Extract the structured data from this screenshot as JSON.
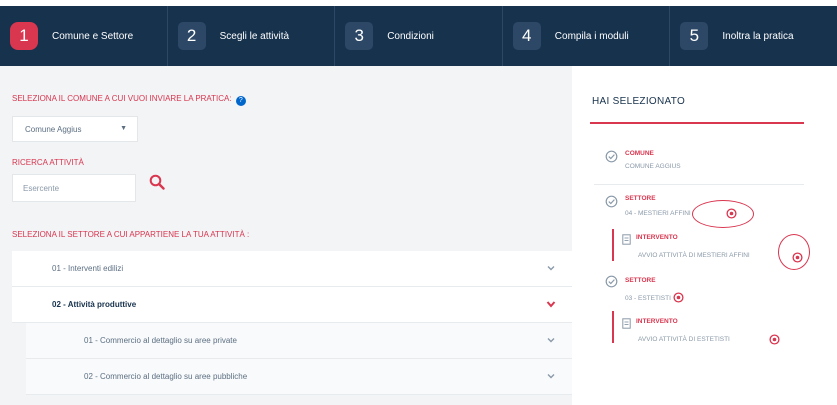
{
  "steps": [
    {
      "num": "1",
      "label": "Comune e Settore"
    },
    {
      "num": "2",
      "label": "Scegli le attività"
    },
    {
      "num": "3",
      "label": "Condizioni"
    },
    {
      "num": "4",
      "label": "Compila i moduli"
    },
    {
      "num": "5",
      "label": "Inoltra la pratica"
    }
  ],
  "left": {
    "comune_label": "SELEZIONA IL COMUNE A CUI VUOI INVIARE LA PRATICA:",
    "comune_select": "Comune Aggius",
    "ricerca_label": "RICERCA ATTIVITÀ",
    "search_placeholder": "Esercente",
    "settore_label": "SELEZIONA IL SETTORE A CUI APPARTIENE LA TUA ATTIVITÀ :",
    "sectors": [
      {
        "label": "01 - Interventi edilizi"
      },
      {
        "label": "02 - Attività produttive"
      },
      {
        "label": "01 - Commercio al dettaglio su aree private"
      },
      {
        "label": "02 - Commercio al dettaglio su aree pubbliche"
      }
    ]
  },
  "right": {
    "title": "HAI SELEZIONATO",
    "comune_key": "COMUNE",
    "comune_val": "COMUNE AGGIUS",
    "settore1_key": "SETTORE",
    "settore1_val": "04 - MESTIERI AFFINI",
    "intervento1_key": "INTERVENTO",
    "intervento1_val": "AVVIO ATTIVITÀ DI MESTIERI AFFINI",
    "settore2_key": "SETTORE",
    "settore2_val": "03 - ESTETISTI",
    "intervento2_key": "INTERVENTO",
    "intervento2_val": "AVVIO ATTIVITÀ DI ESTETISTI"
  },
  "colors": {
    "navy": "#17324d",
    "accent_red": "#d9364f",
    "help_blue": "#0066cc"
  }
}
